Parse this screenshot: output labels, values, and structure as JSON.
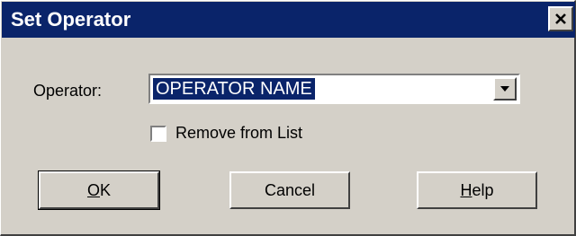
{
  "window": {
    "title": "Set Operator",
    "close_icon": "close-icon"
  },
  "form": {
    "operator_label": "Operator:",
    "operator_value": "OPERATOR NAME",
    "dropdown_icon": "chevron-down-icon",
    "remove_label": "Remove from List",
    "remove_checked": false
  },
  "buttons": {
    "ok_mnemonic": "O",
    "ok_rest": "K",
    "cancel": "Cancel",
    "help_mnemonic": "H",
    "help_rest": "elp"
  },
  "colors": {
    "titlebar": "#0a246a",
    "face": "#d4d0c8",
    "selection": "#0a246a"
  }
}
